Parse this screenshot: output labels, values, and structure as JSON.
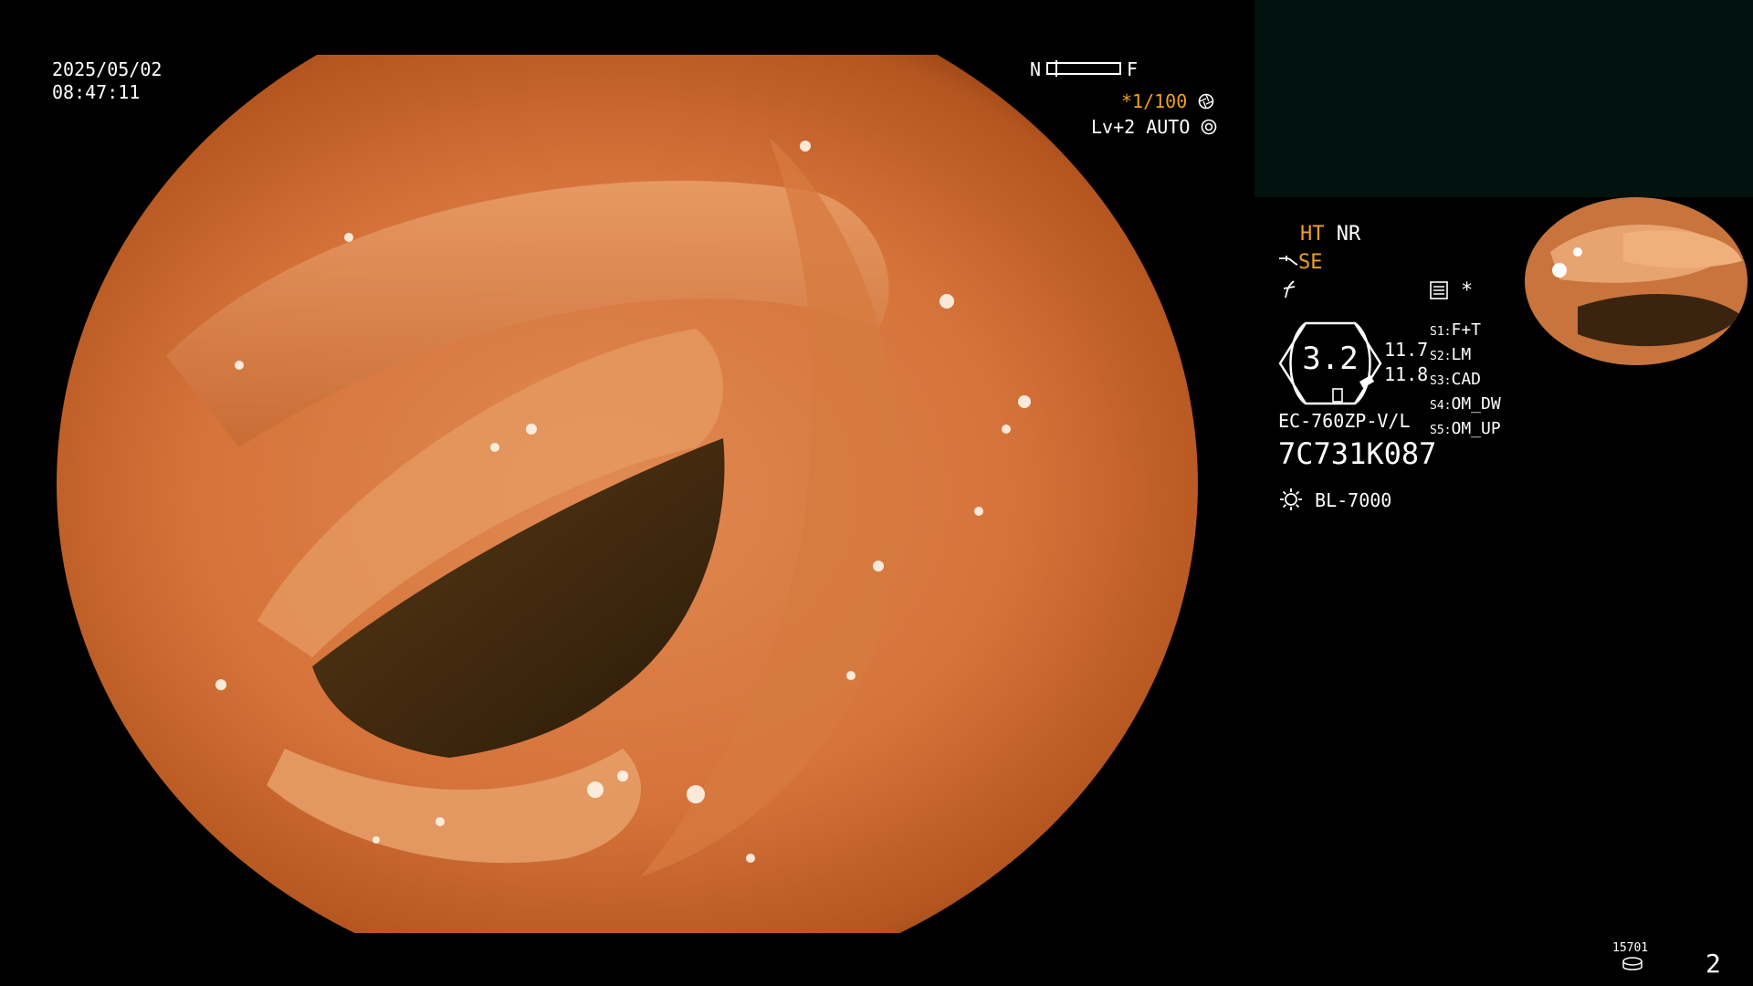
{
  "osd": {
    "date": "2025/05/02",
    "time": "08:47:11",
    "focus_near_label": "N",
    "focus_far_label": "F",
    "focus_level": 0.1,
    "shutter": "*1/100",
    "iris_mode": "Lv+2 AUTO"
  },
  "settings": {
    "ht_label": "HT",
    "nr_label": "NR",
    "se_label": "SE",
    "star_label": "*",
    "zoom_value": "3.2",
    "measure_top": "11.7",
    "measure_bottom": "11.8",
    "scope_model": "EC-760ZP-V/L",
    "serial": "7C731K087",
    "light_source": "BL-7000",
    "scope_switches": [
      {
        "key": "S1:",
        "value": "F+T"
      },
      {
        "key": "S2:",
        "value": "LM"
      },
      {
        "key": "S3:",
        "value": "CAD"
      },
      {
        "key": "S4:",
        "value": "OM_DW"
      },
      {
        "key": "S5:",
        "value": "OM_UP"
      }
    ]
  },
  "footer": {
    "counter": "15701",
    "page_number": "2"
  },
  "icons": {
    "shutter": "aperture-icon",
    "iris": "iris-icon",
    "se": "scope-se-icon",
    "lightning": "flash-icon",
    "memo": "memo-icon",
    "light": "sun-icon",
    "storage": "disk-icon"
  },
  "colors": {
    "accent_orange": "#f0a020",
    "background": "#000000",
    "text": "#ffffff"
  }
}
